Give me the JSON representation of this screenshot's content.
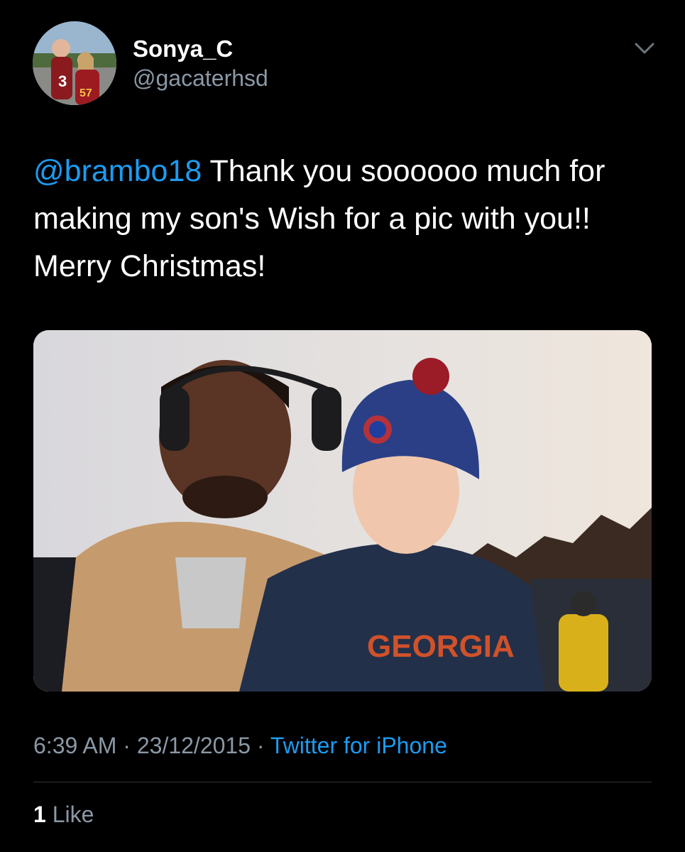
{
  "tweet": {
    "display_name": "Sonya_C",
    "handle": "@gacaterhsd",
    "mention": "@brambo18",
    "text": " Thank you soooooo much for making my son's Wish for a pic with you!! Merry Christmas!",
    "time": "6:39 AM",
    "date": "23/12/2015",
    "separator": "·",
    "source": "Twitter for iPhone",
    "like_count": "1",
    "like_label": "Like"
  },
  "icons": {
    "menu": "chevron-down-icon"
  },
  "colors": {
    "background": "#000000",
    "link": "#1d9bf0",
    "secondary_text": "#8b98a5"
  }
}
